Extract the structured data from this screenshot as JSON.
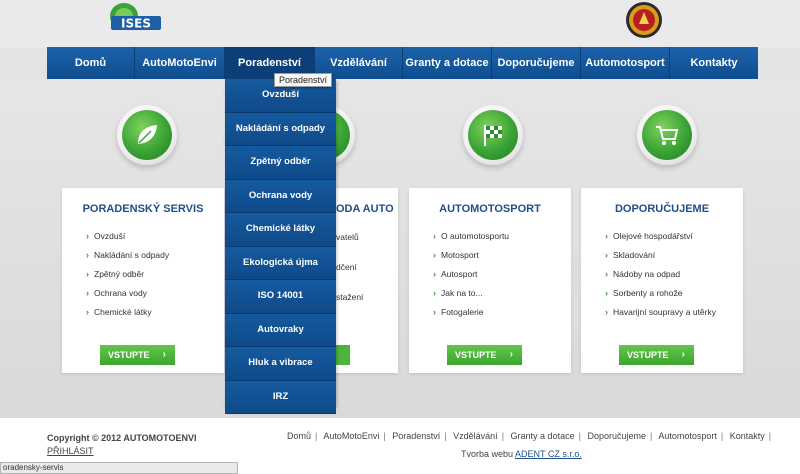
{
  "logo_text": "ISES",
  "nav": {
    "items": [
      "Domů",
      "AutoMotoEnvi",
      "Poradenství",
      "Vzdělávání",
      "Granty a dotace",
      "Doporučujeme",
      "Automotosport",
      "Kontakty"
    ],
    "active_index": 2
  },
  "tooltip": "Poradenství",
  "dropdown": {
    "items": [
      "Ovzduší",
      "Nakládání s odpady",
      "Zpětný odběr",
      "Ochrana vody",
      "Chemické látky",
      "Ekologická újma",
      "ISO 14001",
      "Autovraky",
      "Hluk a vibrace",
      "IRZ"
    ]
  },
  "icons": [
    "leaf-icon",
    "recycle-icon",
    "racing-flag-icon",
    "shopping-cart-icon"
  ],
  "cards": [
    {
      "title": "PORADENSKÝ SERVIS",
      "items": [
        "Ovzduší",
        "Nakládání s odpady",
        "Zpětný odběr",
        "Ochrana vody",
        "Chemické látky"
      ],
      "button": "VSTUPTE"
    },
    {
      "title": "AUTOMOTOSPORT",
      "items": [
        "O automotosportu",
        "Motosport",
        "Autosport",
        "Jak na to...",
        "Fotogalerie"
      ],
      "button": "VSTUPTE"
    },
    {
      "title": "DOPORUČUJEME",
      "items": [
        "Olejové hospodářství",
        "Skladování",
        "Nádoby na odpad",
        "Sorbenty a rohože",
        "Havarijní soupravy a utěrky"
      ],
      "button": "VSTUPTE"
    }
  ],
  "partial_card": {
    "title": "ODA AUTO",
    "lines": [
      "vatelů",
      "dčení",
      "stažení"
    ]
  },
  "footer": {
    "copyright": "Copyright © 2012 AUTOMOTOENVI",
    "login": "PŘIHLÁSIT",
    "links": [
      "Domů",
      "AutoMotoEnvi",
      "Poradenství",
      "Vzdělávání",
      "Granty a dotace",
      "Doporučujeme",
      "Automotosport",
      "Kontakty"
    ],
    "credit_prefix": "Tvorba webu",
    "credit_link": "ADENT CZ s.r.o."
  },
  "status_url": "oradensky-servis",
  "colors": {
    "nav_blue": "#0e4d8f",
    "title_blue": "#1f4f8a",
    "green": "#3ca52e"
  }
}
